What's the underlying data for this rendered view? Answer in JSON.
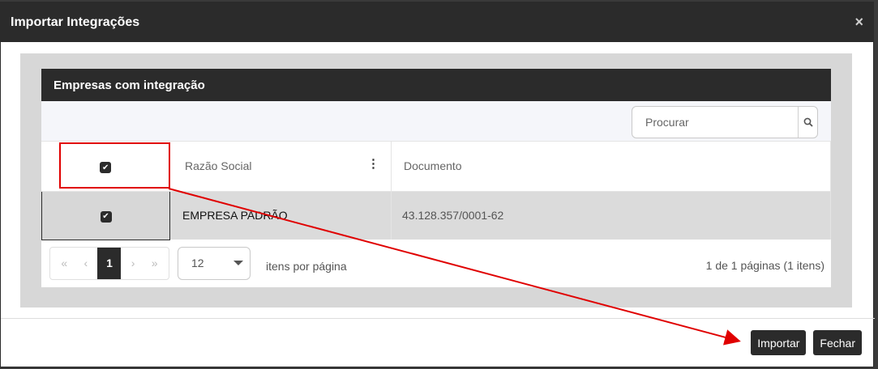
{
  "modal": {
    "title": "Importar Integrações",
    "close_label": "×"
  },
  "panel": {
    "title": "Empresas com integração"
  },
  "search": {
    "placeholder": "Procurar"
  },
  "table": {
    "columns": [
      "Razão Social",
      "Documento"
    ],
    "rows": [
      {
        "razao_social": "EMPRESA PADRÃO",
        "documento": "43.128.357/0001-62",
        "checked": true
      }
    ]
  },
  "pagination": {
    "first": "«",
    "prev": "‹",
    "current": "1",
    "next": "›",
    "last": "»",
    "page_size": "12",
    "per_page_label": "itens por página",
    "page_info": "1 de 1 páginas (1 itens)"
  },
  "actions": {
    "import_label": "Importar",
    "close_label": "Fechar"
  },
  "colors": {
    "dark": "#2b2b2b",
    "annotation": "#e00000"
  }
}
